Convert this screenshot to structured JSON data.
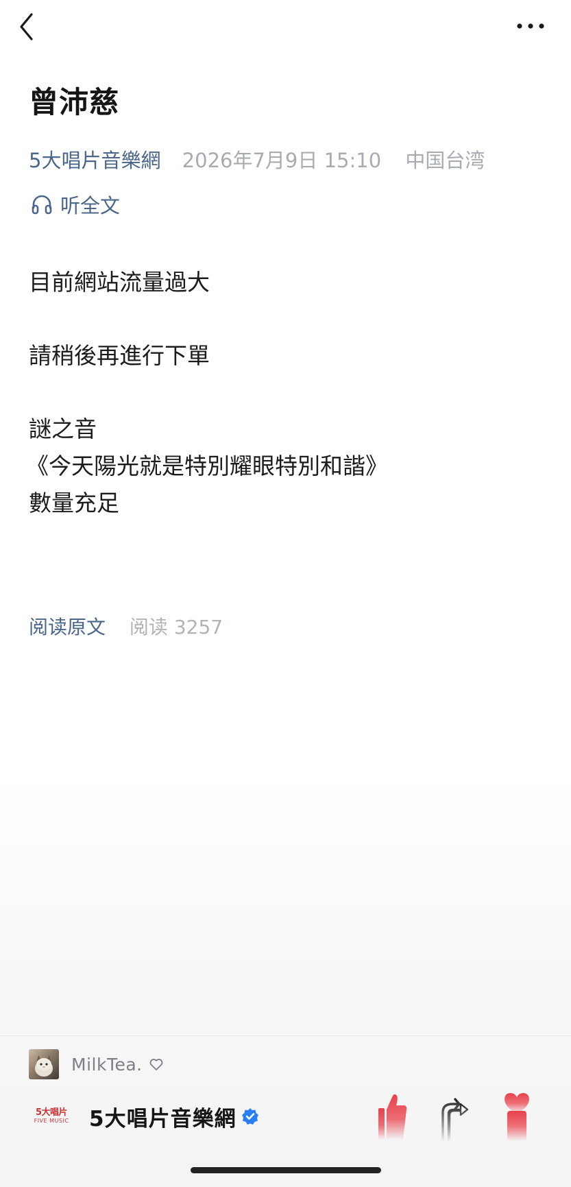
{
  "nav": {
    "back_icon": "chevron-left-icon",
    "more_icon": "more-horizontal-icon"
  },
  "article": {
    "title": "曾沛慈",
    "author": "5大唱片音樂網",
    "date": "2026年7月9日 15:10",
    "location": "中国台湾",
    "listen_icon": "headphones-icon",
    "listen_label": "听全文",
    "body": {
      "line1": "目前網站流量過大",
      "line2": "請稍後再進行下單",
      "line3": "謎之音",
      "line4": "《今天陽光就是特別耀眼特別和諧》",
      "line5": "數量充足"
    },
    "read_original": "阅读原文",
    "read_count": "阅读 3257"
  },
  "comment": {
    "user_name": "MilkTea.",
    "heart_icon": "heart-outline-icon"
  },
  "author_bar": {
    "logo_line1": "5大唱片",
    "logo_line2": "FIVE MUSIC",
    "name": "5大唱片音樂網",
    "verified_icon": "verified-badge-icon"
  },
  "actions": {
    "like_icon": "thumbs-up-icon",
    "share_icon": "share-arrow-icon",
    "favorite_icon": "heart-filled-icon"
  },
  "colors": {
    "link": "#4a6688",
    "muted": "#a8abb0",
    "accent_red": "#e8414b",
    "verified_blue": "#2a7ef4"
  }
}
